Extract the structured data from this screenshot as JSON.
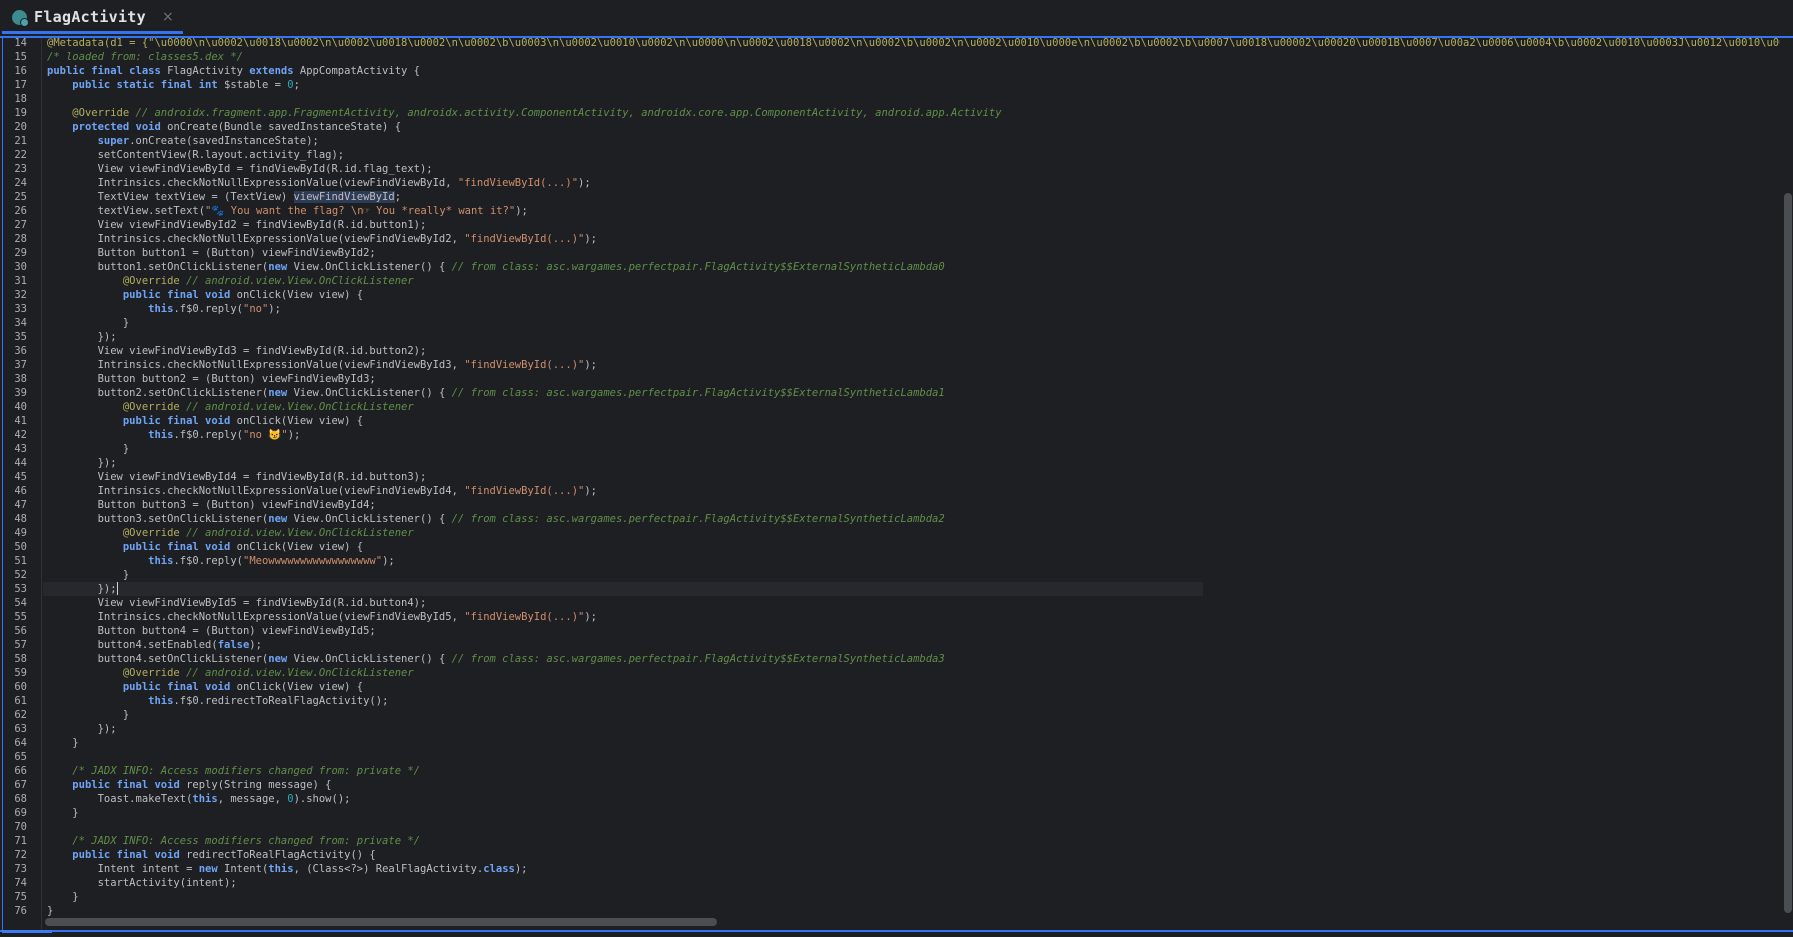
{
  "tab": {
    "title": "FlagActivity",
    "close": "×",
    "icon": "class-file-icon"
  },
  "editor": {
    "line_numbers": [
      "14",
      "15",
      "16",
      "17",
      "18",
      "19",
      "20",
      "21",
      "22",
      "23",
      "24",
      "25",
      "26",
      "27",
      "28",
      "29",
      "30",
      "31",
      "32",
      "33",
      "34",
      "35",
      "36",
      "37",
      "38",
      "39",
      "40",
      "41",
      "42",
      "43",
      "44",
      "45",
      "46",
      "47",
      "48",
      "49",
      "50",
      "51",
      "52",
      "53",
      "54",
      "55",
      "56",
      "57",
      "58",
      "59",
      "60",
      "61",
      "62",
      "63",
      "64",
      "65",
      "66",
      "67",
      "68",
      "69",
      "70",
      "71",
      "72",
      "73",
      "74",
      "75",
      "76"
    ],
    "lines": [
      [
        {
          "t": "@Metadata(d1 = {\"\\u0000\\n\\u0002\\u0018\\u0002\\n\\u0002\\u0018\\u0002\\n\\u0002\\b\\u0003\\n\\u0002\\u0010\\u0002\\n\\u0000\\n\\u0002\\u0018\\u0002\\n\\u0002\\b\\u0002\\n\\u0002\\u0010\\u000e\\n\\u0002\\b\\u0002\\b\\u0007\\u0018\\u00002\\u00020\\u0001B\\u0007\\u00a2\\u0006\\u0004\\b\\u0002\\u0010\\u0003J\\u0012\\u0010\\u0004\\u001a\\u00020\\u0",
          "c": "an"
        }
      ],
      [
        {
          "t": "/* loaded from: classes5.dex */",
          "c": "cm"
        }
      ],
      [
        {
          "t": "public final class ",
          "c": "kw"
        },
        {
          "t": "FlagActivity "
        },
        {
          "t": "extends ",
          "c": "kw"
        },
        {
          "t": "AppCompatActivity {"
        }
      ],
      [
        {
          "t": "    "
        },
        {
          "t": "public static final int ",
          "c": "kw"
        },
        {
          "t": "$stable = "
        },
        {
          "t": "0",
          "c": "num"
        },
        {
          "t": ";"
        }
      ],
      [],
      [
        {
          "t": "    "
        },
        {
          "t": "@Override ",
          "c": "an"
        },
        {
          "t": "// androidx.fragment.app.FragmentActivity, androidx.activity.ComponentActivity, androidx.core.app.ComponentActivity, android.app.Activity",
          "c": "cm"
        }
      ],
      [
        {
          "t": "    "
        },
        {
          "t": "protected void ",
          "c": "kw"
        },
        {
          "t": "onCreate(Bundle savedInstanceState) {"
        }
      ],
      [
        {
          "t": "        "
        },
        {
          "t": "super",
          "c": "kw"
        },
        {
          "t": ".onCreate(savedInstanceState);"
        }
      ],
      [
        {
          "t": "        setContentView(R.layout.activity_flag);"
        }
      ],
      [
        {
          "t": "        View viewFindViewById = findViewById(R.id.flag_text);"
        }
      ],
      [
        {
          "t": "        Intrinsics.checkNotNullExpressionValue(viewFindViewById, "
        },
        {
          "t": "\"findViewById(...)\"",
          "c": "str"
        },
        {
          "t": ");"
        }
      ],
      [
        {
          "t": "        TextView textView = (TextView) "
        },
        {
          "t": "viewFindViewById",
          "c": "hl"
        },
        {
          "t": ";"
        }
      ],
      [
        {
          "t": "        textView.setText("
        },
        {
          "t": "\"🐾 You want the flag? \\n☞ You *really* want it?\"",
          "c": "str"
        },
        {
          "t": ");"
        }
      ],
      [
        {
          "t": "        View viewFindViewById2 = findViewById(R.id.button1);"
        }
      ],
      [
        {
          "t": "        Intrinsics.checkNotNullExpressionValue(viewFindViewById2, "
        },
        {
          "t": "\"findViewById(...)\"",
          "c": "str"
        },
        {
          "t": ");"
        }
      ],
      [
        {
          "t": "        Button button1 = (Button) viewFindViewById2;"
        }
      ],
      [
        {
          "t": "        button1.setOnClickListener("
        },
        {
          "t": "new ",
          "c": "kw"
        },
        {
          "t": "View.OnClickListener() { "
        },
        {
          "t": "// from class: asc.wargames.perfectpair.FlagActivity$$ExternalSyntheticLambda0",
          "c": "cm"
        }
      ],
      [
        {
          "t": "            "
        },
        {
          "t": "@Override ",
          "c": "an"
        },
        {
          "t": "// android.view.View.OnClickListener",
          "c": "cm"
        }
      ],
      [
        {
          "t": "            "
        },
        {
          "t": "public final void ",
          "c": "kw"
        },
        {
          "t": "onClick(View view) {"
        }
      ],
      [
        {
          "t": "                "
        },
        {
          "t": "this",
          "c": "kw"
        },
        {
          "t": ".f$0.reply("
        },
        {
          "t": "\"no\"",
          "c": "str"
        },
        {
          "t": ");"
        }
      ],
      [
        {
          "t": "            }"
        }
      ],
      [
        {
          "t": "        });"
        }
      ],
      [
        {
          "t": "        View viewFindViewById3 = findViewById(R.id.button2);"
        }
      ],
      [
        {
          "t": "        Intrinsics.checkNotNullExpressionValue(viewFindViewById3, "
        },
        {
          "t": "\"findViewById(...)\"",
          "c": "str"
        },
        {
          "t": ");"
        }
      ],
      [
        {
          "t": "        Button button2 = (Button) viewFindViewById3;"
        }
      ],
      [
        {
          "t": "        button2.setOnClickListener("
        },
        {
          "t": "new ",
          "c": "kw"
        },
        {
          "t": "View.OnClickListener() { "
        },
        {
          "t": "// from class: asc.wargames.perfectpair.FlagActivity$$ExternalSyntheticLambda1",
          "c": "cm"
        }
      ],
      [
        {
          "t": "            "
        },
        {
          "t": "@Override ",
          "c": "an"
        },
        {
          "t": "// android.view.View.OnClickListener",
          "c": "cm"
        }
      ],
      [
        {
          "t": "            "
        },
        {
          "t": "public final void ",
          "c": "kw"
        },
        {
          "t": "onClick(View view) {"
        }
      ],
      [
        {
          "t": "                "
        },
        {
          "t": "this",
          "c": "kw"
        },
        {
          "t": ".f$0.reply("
        },
        {
          "t": "\"no 😼\"",
          "c": "str"
        },
        {
          "t": ");"
        }
      ],
      [
        {
          "t": "            }"
        }
      ],
      [
        {
          "t": "        });"
        }
      ],
      [
        {
          "t": "        View viewFindViewById4 = findViewById(R.id.button3);"
        }
      ],
      [
        {
          "t": "        Intrinsics.checkNotNullExpressionValue(viewFindViewById4, "
        },
        {
          "t": "\"findViewById(...)\"",
          "c": "str"
        },
        {
          "t": ");"
        }
      ],
      [
        {
          "t": "        Button button3 = (Button) viewFindViewById4;"
        }
      ],
      [
        {
          "t": "        button3.setOnClickListener("
        },
        {
          "t": "new ",
          "c": "kw"
        },
        {
          "t": "View.OnClickListener() { "
        },
        {
          "t": "// from class: asc.wargames.perfectpair.FlagActivity$$ExternalSyntheticLambda2",
          "c": "cm"
        }
      ],
      [
        {
          "t": "            "
        },
        {
          "t": "@Override ",
          "c": "an"
        },
        {
          "t": "// android.view.View.OnClickListener",
          "c": "cm"
        }
      ],
      [
        {
          "t": "            "
        },
        {
          "t": "public final void ",
          "c": "kw"
        },
        {
          "t": "onClick(View view) {"
        }
      ],
      [
        {
          "t": "                "
        },
        {
          "t": "this",
          "c": "kw"
        },
        {
          "t": ".f$0.reply("
        },
        {
          "t": "\"Meowwwwwwwwwwwwwwwww\"",
          "c": "str"
        },
        {
          "t": ");"
        }
      ],
      [
        {
          "t": "            }"
        }
      ],
      [
        {
          "t": "        });"
        },
        {
          "t": "",
          "c": "caret"
        }
      ],
      [
        {
          "t": "        View viewFindViewById5 = findViewById(R.id.button4);"
        }
      ],
      [
        {
          "t": "        Intrinsics.checkNotNullExpressionValue(viewFindViewById5, "
        },
        {
          "t": "\"findViewById(...)\"",
          "c": "str"
        },
        {
          "t": ");"
        }
      ],
      [
        {
          "t": "        Button button4 = (Button) viewFindViewById5;"
        }
      ],
      [
        {
          "t": "        button4.setEnabled("
        },
        {
          "t": "false",
          "c": "kw"
        },
        {
          "t": ");"
        }
      ],
      [
        {
          "t": "        button4.setOnClickListener("
        },
        {
          "t": "new ",
          "c": "kw"
        },
        {
          "t": "View.OnClickListener() { "
        },
        {
          "t": "// from class: asc.wargames.perfectpair.FlagActivity$$ExternalSyntheticLambda3",
          "c": "cm"
        }
      ],
      [
        {
          "t": "            "
        },
        {
          "t": "@Override ",
          "c": "an"
        },
        {
          "t": "// android.view.View.OnClickListener",
          "c": "cm"
        }
      ],
      [
        {
          "t": "            "
        },
        {
          "t": "public final void ",
          "c": "kw"
        },
        {
          "t": "onClick(View view) {"
        }
      ],
      [
        {
          "t": "                "
        },
        {
          "t": "this",
          "c": "kw"
        },
        {
          "t": ".f$0.redirectToRealFlagActivity();"
        }
      ],
      [
        {
          "t": "            }"
        }
      ],
      [
        {
          "t": "        });"
        }
      ],
      [
        {
          "t": "    }"
        }
      ],
      [],
      [
        {
          "t": "    "
        },
        {
          "t": "/* JADX INFO: Access modifiers changed from: private */",
          "c": "cm"
        }
      ],
      [
        {
          "t": "    "
        },
        {
          "t": "public final void ",
          "c": "kw"
        },
        {
          "t": "reply(String message) {"
        }
      ],
      [
        {
          "t": "        Toast.makeText("
        },
        {
          "t": "this",
          "c": "kw"
        },
        {
          "t": ", message, "
        },
        {
          "t": "0",
          "c": "num"
        },
        {
          "t": ").show();"
        }
      ],
      [
        {
          "t": "    }"
        }
      ],
      [],
      [
        {
          "t": "    "
        },
        {
          "t": "/* JADX INFO: Access modifiers changed from: private */",
          "c": "cm"
        }
      ],
      [
        {
          "t": "    "
        },
        {
          "t": "public final void ",
          "c": "kw"
        },
        {
          "t": "redirectToRealFlagActivity() {"
        }
      ],
      [
        {
          "t": "        Intent intent = "
        },
        {
          "t": "new ",
          "c": "kw"
        },
        {
          "t": "Intent("
        },
        {
          "t": "this",
          "c": "kw"
        },
        {
          "t": ", (Class<?>) RealFlagActivity."
        },
        {
          "t": "class",
          "c": "kw"
        },
        {
          "t": ");"
        }
      ],
      [
        {
          "t": "        startActivity(intent);"
        }
      ],
      [
        {
          "t": "    }"
        }
      ],
      [
        {
          "t": "}"
        }
      ]
    ],
    "current_line": "53"
  },
  "colors": {
    "background": "#1e1f22",
    "accent": "#3574f0",
    "keyword": "#6fa4f5",
    "string": "#cf8e6d",
    "comment": "#5f8f4a",
    "annotation": "#b3ae60",
    "number": "#2aacb8"
  }
}
